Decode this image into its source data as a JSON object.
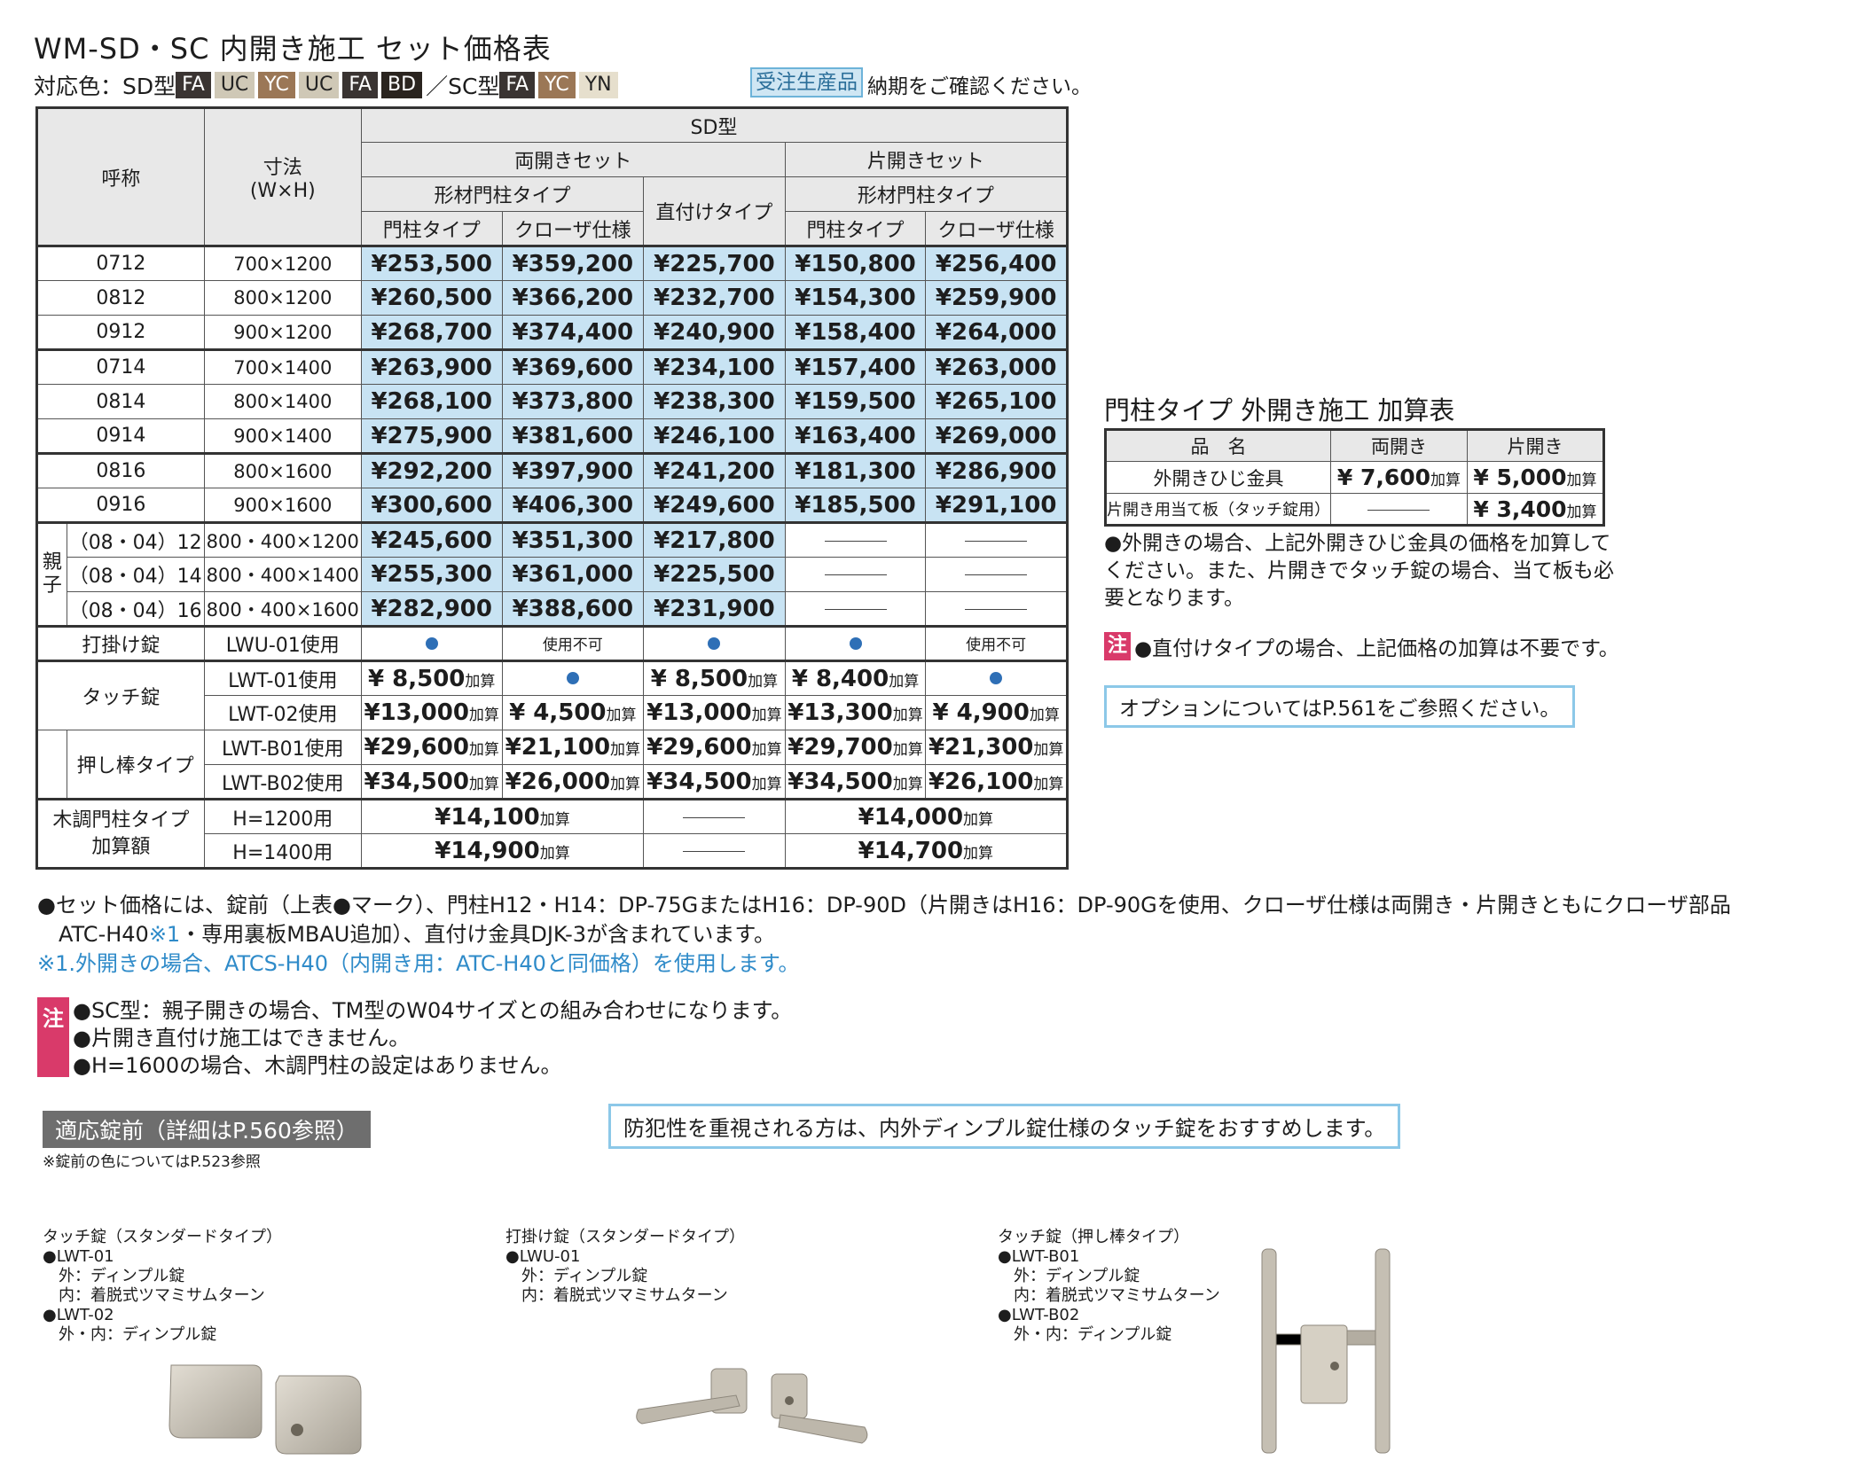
{
  "title": "WM-SD・SC 内開き施工 セット価格表",
  "colors": {
    "label": "対応色：SD型",
    "sd": [
      "FA",
      "UC",
      "YC",
      "UC",
      "FA",
      "BD"
    ],
    "sep": "／SC型",
    "sc": [
      "FA",
      "YC",
      "YN"
    ],
    "ordered": "受注生産品",
    "delivery": "納期をご確認ください。"
  },
  "main": {
    "h_name": "呼称",
    "h_size": "寸法",
    "h_size2": "(W×H)",
    "h_sd": "SD型",
    "h_double": "両開きセット",
    "h_single": "片開きセット",
    "h_frame": "形材門柱タイプ",
    "h_direct": "直付けタイプ",
    "h_post": "門柱タイプ",
    "h_closer": "クローザ仕様",
    "rows": [
      {
        "name": "0712",
        "size": "700×1200",
        "p": [
          "¥253,500",
          "¥359,200",
          "¥225,700",
          "¥150,800",
          "¥256,400"
        ]
      },
      {
        "name": "0812",
        "size": "800×1200",
        "p": [
          "¥260,500",
          "¥366,200",
          "¥232,700",
          "¥154,300",
          "¥259,900"
        ]
      },
      {
        "name": "0912",
        "size": "900×1200",
        "p": [
          "¥268,700",
          "¥374,400",
          "¥240,900",
          "¥158,400",
          "¥264,000"
        ]
      },
      {
        "name": "0714",
        "size": "700×1400",
        "p": [
          "¥263,900",
          "¥369,600",
          "¥234,100",
          "¥157,400",
          "¥263,000"
        ]
      },
      {
        "name": "0814",
        "size": "800×1400",
        "p": [
          "¥268,100",
          "¥373,800",
          "¥238,300",
          "¥159,500",
          "¥265,100"
        ]
      },
      {
        "name": "0914",
        "size": "900×1400",
        "p": [
          "¥275,900",
          "¥381,600",
          "¥246,100",
          "¥163,400",
          "¥269,000"
        ]
      },
      {
        "name": "0816",
        "size": "800×1600",
        "p": [
          "¥292,200",
          "¥397,900",
          "¥241,200",
          "¥181,300",
          "¥286,900"
        ]
      },
      {
        "name": "0916",
        "size": "900×1600",
        "p": [
          "¥300,600",
          "¥406,300",
          "¥249,600",
          "¥185,500",
          "¥291,100"
        ]
      }
    ],
    "oyako_label": "親子",
    "oyako": [
      {
        "name": "（08・04）12",
        "size": "800・400×1200",
        "p": [
          "¥245,600",
          "¥351,300",
          "¥217,800"
        ]
      },
      {
        "name": "（08・04）14",
        "size": "800・400×1400",
        "p": [
          "¥255,300",
          "¥361,000",
          "¥225,500"
        ]
      },
      {
        "name": "（08・04）16",
        "size": "800・400×1600",
        "p": [
          "¥282,900",
          "¥388,600",
          "¥231,900"
        ]
      }
    ],
    "add": "加算",
    "na": "使用不可",
    "uchikake": {
      "label": "打掛け錠",
      "code": "LWU-01使用"
    },
    "touch": {
      "label": "タッチ錠",
      "code1": "LWT-01使用",
      "r1": [
        "¥ 8,500",
        "¥ 8,500",
        "¥ 8,400"
      ],
      "code2": "LWT-02使用",
      "r2": [
        "¥13,000",
        "¥ 4,500",
        "¥13,000",
        "¥13,300",
        "¥ 4,900"
      ]
    },
    "push": {
      "label": "押し棒タイプ",
      "code1": "LWT-B01使用",
      "r1": [
        "¥29,600",
        "¥21,100",
        "¥29,600",
        "¥29,700",
        "¥21,300"
      ],
      "code2": "LWT-B02使用",
      "r2": [
        "¥34,500",
        "¥26,000",
        "¥34,500",
        "¥34,500",
        "¥26,100"
      ]
    },
    "wood": {
      "label1": "木調門柱タイプ",
      "label2": "加算額",
      "h1": "H=1200用",
      "h2": "H=1400用",
      "d1": "¥14,100",
      "s1": "¥14,000",
      "d2": "¥14,900",
      "s2": "¥14,700"
    }
  },
  "sub": {
    "title": "門柱タイプ 外開き施工 加算表",
    "h_item": "品　名",
    "h_double": "両開き",
    "h_single": "片開き",
    "r1": "外開きひじ金具",
    "r1d": "¥ 7,600",
    "r1s": "¥ 5,000",
    "r2": "片開き用当て板（タッチ錠用）",
    "r2s": "¥ 3,400",
    "add": "加算"
  },
  "note1": "●外開きの場合、上記外開きひじ金具の価格を加算してください。また、片開きでタッチ錠の場合、当て板も必要となります。",
  "warn_label": "注",
  "warn2": "●直付けタイプの場合、上記価格の加算は不要です。",
  "option": "オプションについてはP.561をご参照ください。",
  "bignote1": "●セット価格には、錠前（上表●マーク）、門柱H12・H14：DP-75GまたはH16：DP-90D（片開きはH16：DP-90Gを使用、クローザ仕様は両開き・片開きともにクローザ部品",
  "bignote2a": "　ATC-H40",
  "bignote2b": "※1",
  "bignote2c": "・専用裏板MBAU追加）、直付け金具DJK-3が含まれています。",
  "bignote3": "※1.外開きの場合、ATCS-H40（内開き用：ATC-H40と同価格）を使用します。",
  "warnlines": [
    "●SC型：親子開きの場合、TM型のW04サイズとの組み合わせになります。",
    "●片開き直付け施工はできません。",
    "●H=1600の場合、木調門柱の設定はありません。"
  ],
  "lockhead": "適応錠前（詳細はP.560参照）",
  "locknote": "※錠前の色についてはP.523参照",
  "reco": "防犯性を重視される方は、内外ディンプル錠仕様のタッチ錠をおすすめします。",
  "prod1": "タッチ錠（スタンダードタイプ）\n●LWT-01\n　外：ディンプル錠\n　内：着脱式ツマミサムターン\n●LWT-02\n　外・内：ディンプル錠",
  "prod2": "打掛け錠（スタンダードタイプ）\n●LWU-01\n　外：ディンプル錠\n　内：着脱式ツマミサムターン",
  "prod3": "タッチ錠（押し棒タイプ）\n●LWT-B01\n　外：ディンプル錠\n　内：着脱式ツマミサムターン\n●LWT-B02\n　外・内：ディンプル錠"
}
